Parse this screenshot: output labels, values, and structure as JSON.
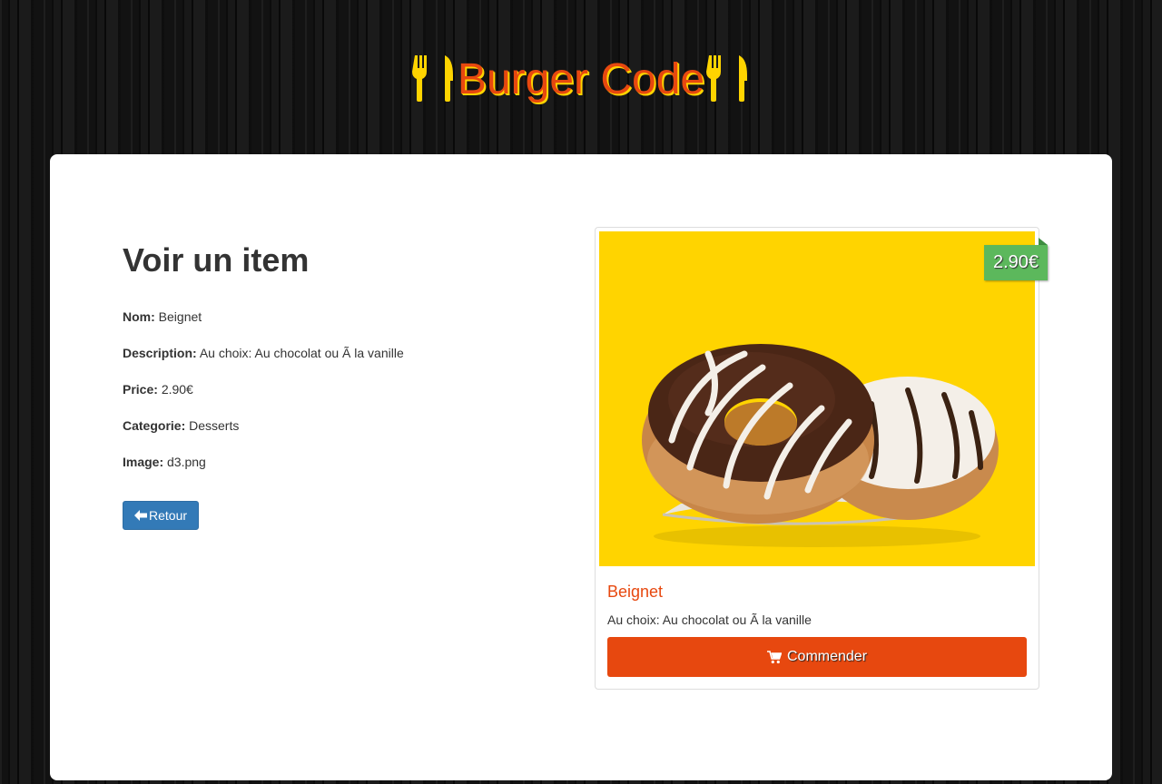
{
  "brand": {
    "name": "Burger Code",
    "icon": "cutlery-icon",
    "text_color": "#e7480f",
    "accent": "#ffd400"
  },
  "page": {
    "title": "Voir un item"
  },
  "fields": [
    {
      "key": "Nom:",
      "value": "Beignet"
    },
    {
      "key": "Description:",
      "value": "Au choix: Au chocolat ou Ã  la vanille"
    },
    {
      "key": "Price:",
      "value": "2.90€"
    },
    {
      "key": "Categorie:",
      "value": "Desserts"
    },
    {
      "key": "Image:",
      "value": "d3.png"
    }
  ],
  "back_button": {
    "label": "Retour",
    "icon": "arrow-left-icon",
    "color": "#337ab7"
  },
  "card": {
    "image": "donut-image",
    "price": "2.90€",
    "price_color": "#5cb85c",
    "title": "Beignet",
    "description": "Au choix: Au chocolat ou Ã  la vanille",
    "order_button": {
      "label": "Commender",
      "icon": "shopping-cart-icon",
      "color": "#e7480f"
    }
  }
}
